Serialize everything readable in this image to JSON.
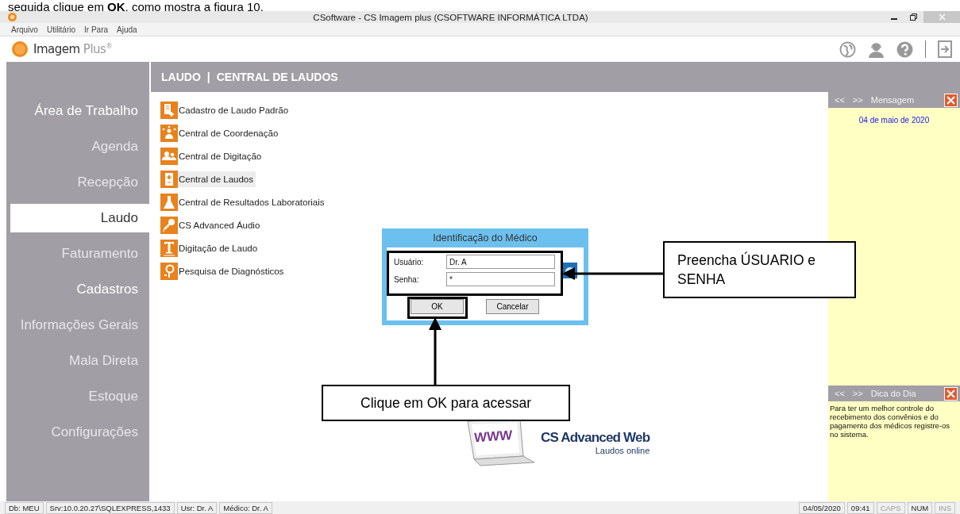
{
  "caption": "seguida clique em **OK**, como mostra a figura 10.",
  "window": {
    "title": "CSoftware - CS Imagem plus (CSOFTWARE INFORMÁTICA LTDA)"
  },
  "menu": [
    "Arquivo",
    "Utilitário",
    "Ir Para",
    "Ajuda"
  ],
  "brand": {
    "name": "Imagem",
    "suffix": "Plus$^{®}$"
  },
  "sidebar": {
    "items": [
      {
        "label": "Área de Trabalho",
        "selected": false,
        "disabled": false
      },
      {
        "label": "Agenda",
        "selected": false,
        "disabled": true
      },
      {
        "label": "Recepção",
        "selected": false,
        "disabled": true
      },
      {
        "label": "Laudo",
        "selected": true,
        "disabled": false
      },
      {
        "label": "Faturamento",
        "selected": false,
        "disabled": true
      },
      {
        "label": "Cadastros",
        "selected": false,
        "disabled": false
      },
      {
        "label": "Informações Gerais",
        "selected": false,
        "disabled": true
      },
      {
        "label": "Mala Direta",
        "selected": false,
        "disabled": true
      },
      {
        "label": "Estoque",
        "selected": false,
        "disabled": true
      },
      {
        "label": "Configurações",
        "selected": false,
        "disabled": true
      }
    ]
  },
  "breadcrumb": {
    "section": "LAUDO",
    "separator": "|",
    "page": "CENTRAL DE LAUDOS"
  },
  "modules": [
    {
      "label": "Cadastro de Laudo Padrão",
      "selected": false
    },
    {
      "label": "Central de Coordenação",
      "selected": false
    },
    {
      "label": "Central de Digitação",
      "selected": false
    },
    {
      "label": "Central de Laudos",
      "selected": true
    },
    {
      "label": "Central de Resultados Laboratoriais",
      "selected": false
    },
    {
      "label": "CS Advanced Áudio",
      "selected": false
    },
    {
      "label": "Digitação de Laudo",
      "selected": false
    },
    {
      "label": "Pesquisa de Diagnósticos",
      "selected": false
    }
  ],
  "dialog": {
    "title": "Identificação do Médico",
    "fields": [
      {
        "label": "Usuário:",
        "value": "Dr. A"
      },
      {
        "label": "Senha:",
        "value": "*"
      }
    ],
    "buttons": [
      "OK",
      "Cancelar"
    ]
  },
  "callouts": [
    "Preencha ÚSUARIO e SENHA",
    "Clique em OK para acessar"
  ],
  "message_panel": {
    "prev": "<<",
    "next": ">>",
    "title": "Mensagem",
    "date": "04 de maio de 2020"
  },
  "tip_panel": {
    "prev": "<<",
    "next": ">>",
    "title": "Dica do Dia",
    "text": "Para ter um melhor controle do recebimento dos convênios e do pagamento dos médicos registre-os no sistema."
  },
  "ad": {
    "screen_text": "WWW",
    "title": "CS Advanced Web",
    "subtitle": "Laudos online"
  },
  "status_bar": {
    "left": [
      "Db: MEU",
      "Srv:10.0.20.27\\SQLEXPRESS,1433",
      "Usr: Dr. A",
      "Médico: Dr. A"
    ],
    "right": [
      {
        "text": "04/05/2020",
        "disabled": false
      },
      {
        "text": "09:41",
        "disabled": false
      },
      {
        "text": "CAPS",
        "disabled": true
      },
      {
        "text": "NUM",
        "disabled": false
      },
      {
        "text": "INS",
        "disabled": true
      }
    ]
  }
}
